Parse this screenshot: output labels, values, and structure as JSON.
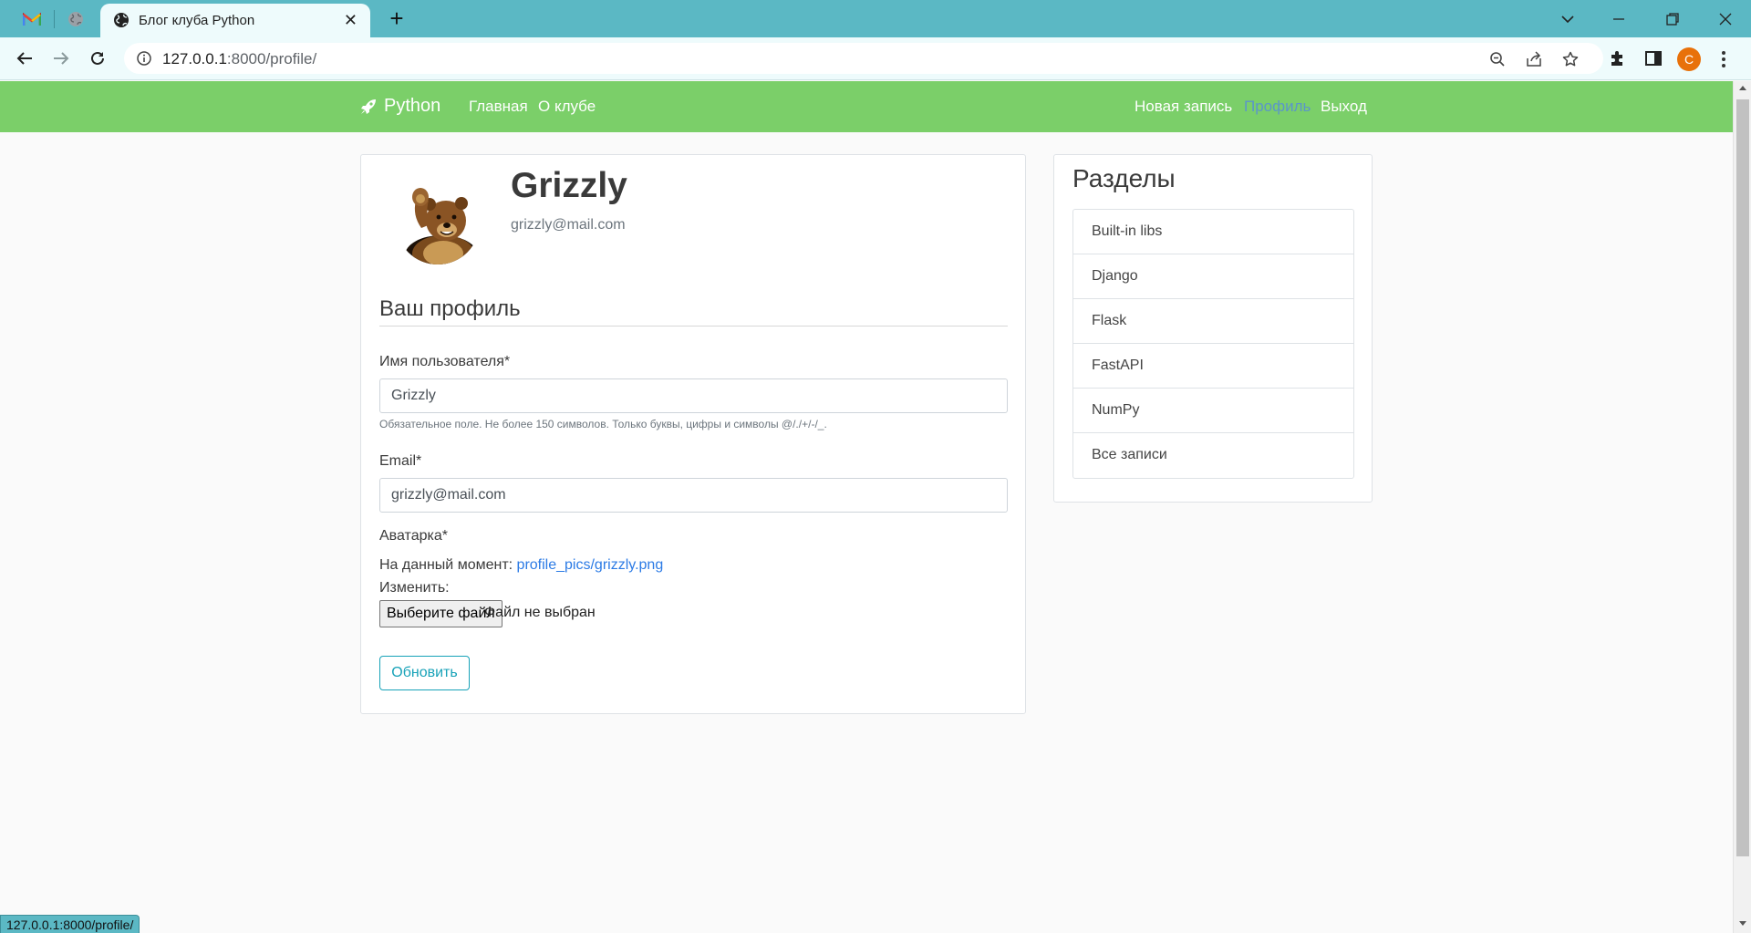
{
  "browser": {
    "tab_title": "Блог клуба Python",
    "url_host": "127.0.0.1",
    "url_rest": ":8000/profile/",
    "profile_initial": "C",
    "status_url": "127.0.0.1:8000/profile/"
  },
  "nav": {
    "brand": "Python",
    "links_left": [
      "Главная",
      "О клубе"
    ],
    "links_right": [
      "Новая запись",
      "Профиль",
      "Выход"
    ],
    "active": "Профиль",
    "bg_color": "#7bcf69"
  },
  "profile": {
    "username": "Grizzly",
    "email": "grizzly@mail.com",
    "section_title": "Ваш профиль",
    "username_label": "Имя пользователя*",
    "username_value": "Grizzly",
    "username_help": "Обязательное поле. Не более 150 символов. Только буквы, цифры и символы @/./+/-/_.",
    "email_label": "Email*",
    "email_value": "grizzly@mail.com",
    "avatar_label": "Аватарка*",
    "current_prefix": "На данный момент:",
    "current_file": "profile_pics/grizzly.png",
    "change_label": "Изменить:",
    "choose_file": "Выберите файл",
    "no_file": "Файл не выбран",
    "submit": "Обновить"
  },
  "sidebar": {
    "title": "Разделы",
    "items": [
      "Built-in libs",
      "Django",
      "Flask",
      "FastAPI",
      "NumPy",
      "Все записи"
    ]
  }
}
